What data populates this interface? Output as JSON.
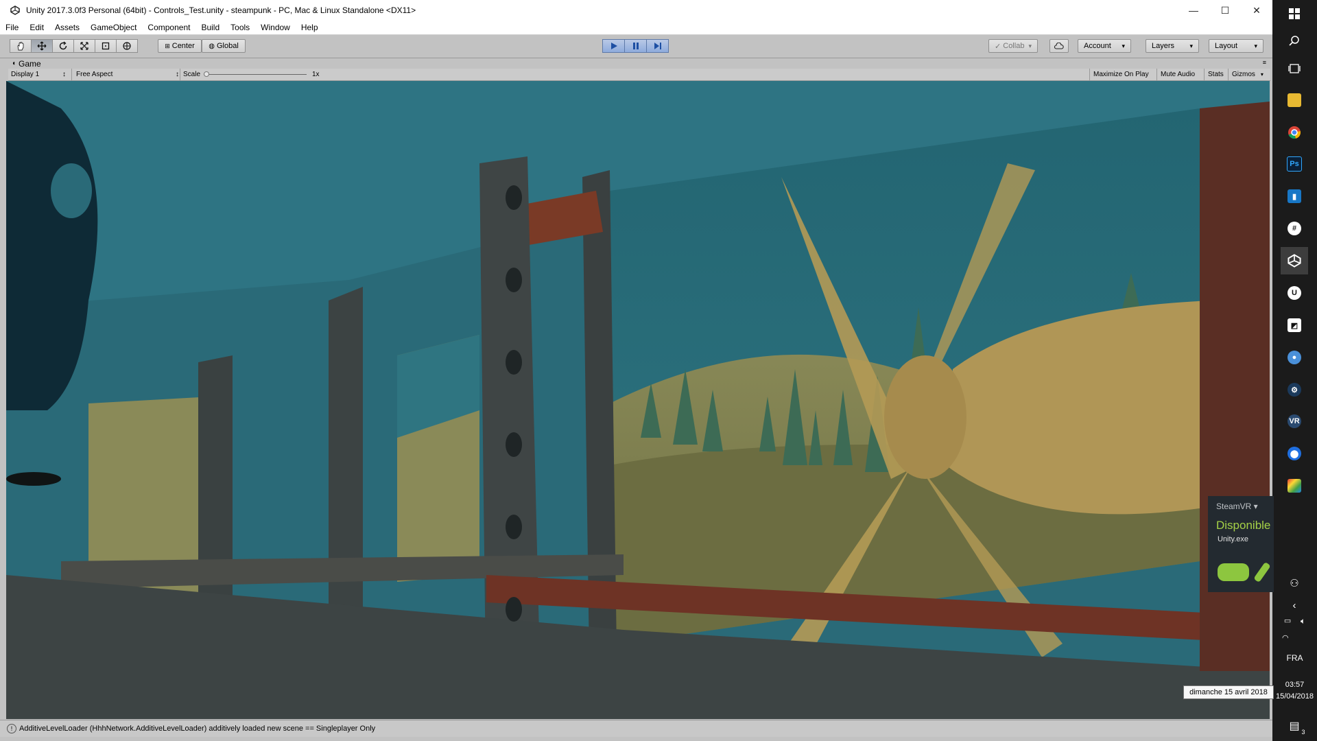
{
  "window": {
    "title": "Unity 2017.3.0f3 Personal (64bit) - Controls_Test.unity - steampunk - PC, Mac & Linux Standalone <DX11>",
    "minimize": "—",
    "maximize": "☐",
    "close": "✕"
  },
  "menu": [
    "File",
    "Edit",
    "Assets",
    "GameObject",
    "Component",
    "Build",
    "Tools",
    "Window",
    "Help"
  ],
  "toolbar": {
    "center": "Center",
    "global": "Global",
    "collab": "Collab",
    "account": "Account",
    "layers": "Layers",
    "layout": "Layout"
  },
  "game_view": {
    "tab": "Game",
    "display": "Display 1",
    "aspect": "Free Aspect",
    "scale_label": "Scale",
    "scale_value": "1x",
    "scale_fraction": 0.0,
    "maximize": "Maximize On Play",
    "mute": "Mute Audio",
    "stats": "Stats",
    "gizmos": "Gizmos"
  },
  "status": {
    "message": "AdditiveLevelLoader (HhhNetwork.AdditiveLevelLoader) additively loaded new scene == Singleplayer Only"
  },
  "steamvr": {
    "label": "SteamVR ▾",
    "status": "Disponible",
    "app": "Unity.exe"
  },
  "systray": {
    "lang": "FRA",
    "time": "03:57",
    "date": "15/04/2018",
    "tooltip": "dimanche 15 avril 2018",
    "notif_count": "3"
  },
  "colors": {
    "play_accent": "#5d79a8",
    "steamvr_green": "#a5d146",
    "taskbar_bg": "#1b1b1b"
  }
}
